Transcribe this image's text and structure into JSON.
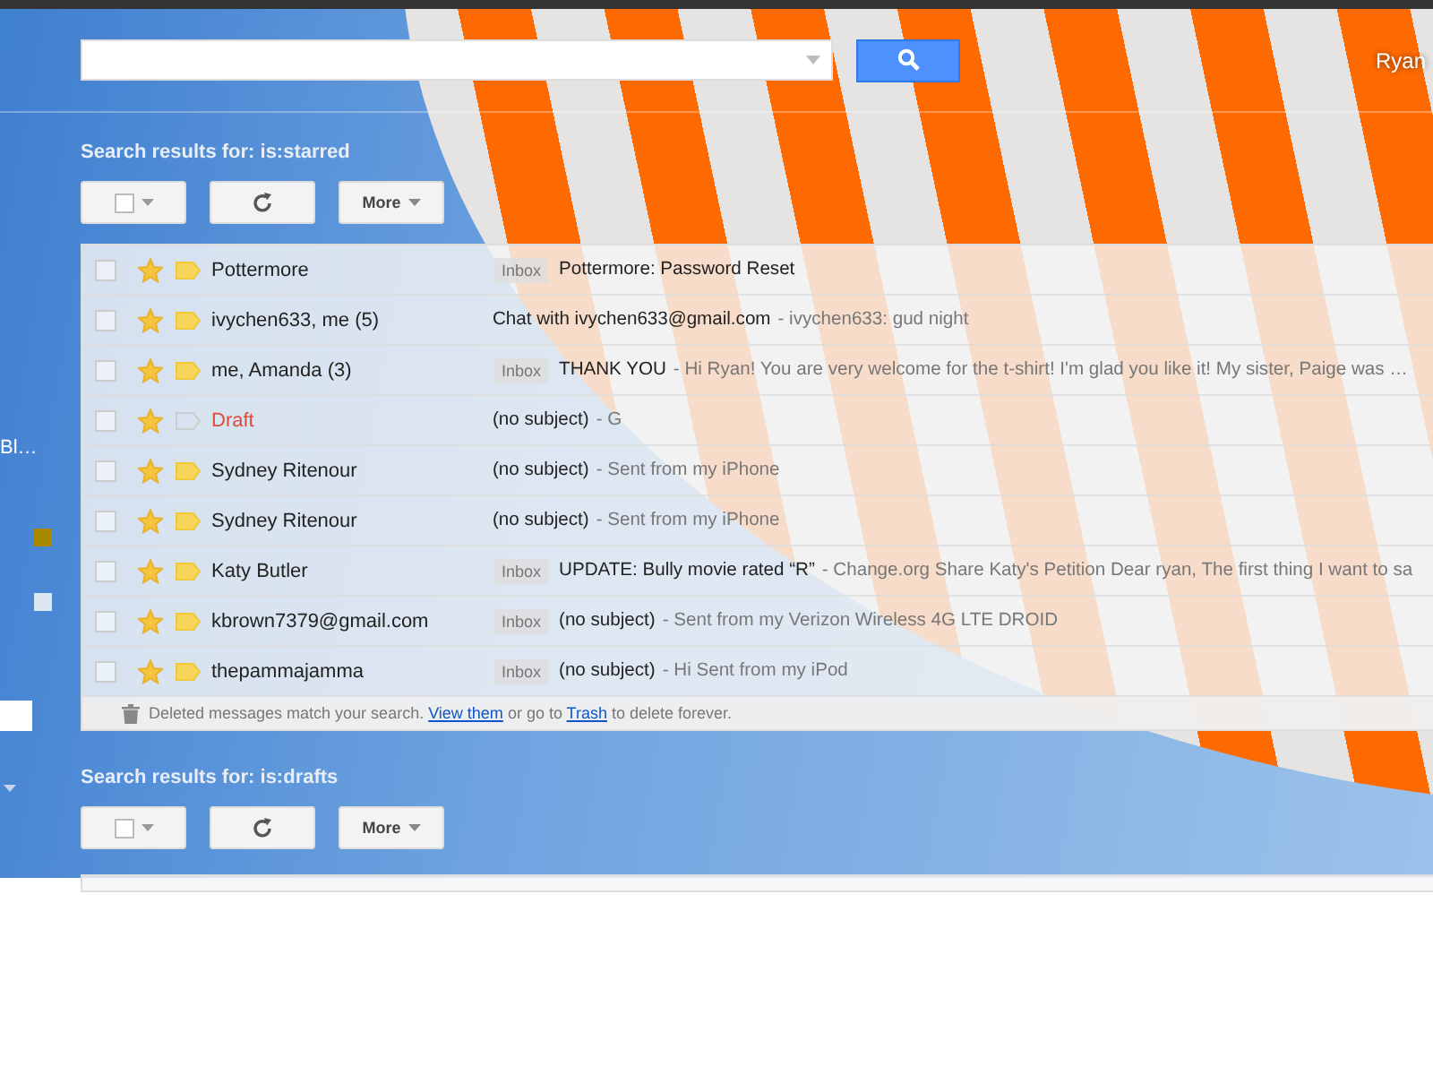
{
  "header": {
    "account": "Ryan"
  },
  "sidebar": {
    "label": "Bl…",
    "label_squares": [
      {
        "color": "#a88a00"
      },
      {
        "color": "#dde4f2"
      }
    ]
  },
  "sections": [
    {
      "title": "Search results for: is:starred",
      "more": "More",
      "rows": [
        {
          "checked": false,
          "starred": true,
          "important": true,
          "kind": "mail",
          "sender": "Pottermore",
          "badge": "Inbox",
          "subject": "Pottermore: Password Reset"
        },
        {
          "checked": false,
          "starred": true,
          "important": true,
          "kind": "mail",
          "sender": "ivychen633, me (5)",
          "subject": "Chat with ivychen633@gmail.com",
          "snippet": "- ivychen633: gud night"
        },
        {
          "checked": false,
          "starred": true,
          "important": true,
          "kind": "mail",
          "sender": "me, Amanda (3)",
          "badge": "Inbox",
          "subject": "THANK YOU",
          "snippet": "- Hi Ryan! You are very welcome for the t-shirt! I'm glad you like it! My sister, Paige was …"
        },
        {
          "checked": false,
          "starred": true,
          "important": false,
          "kind": "draft",
          "sender": "Draft",
          "subject": "(no subject)",
          "snippet": "- G"
        },
        {
          "checked": false,
          "starred": true,
          "important": true,
          "kind": "mail",
          "sender": "Sydney Ritenour",
          "subject": "(no subject)",
          "snippet": "- Sent from my iPhone"
        },
        {
          "checked": false,
          "starred": true,
          "important": true,
          "kind": "mail",
          "sender": "Sydney Ritenour",
          "subject": "(no subject)",
          "snippet": "- Sent from my iPhone"
        },
        {
          "checked": false,
          "starred": true,
          "important": true,
          "kind": "mail",
          "sender": "Katy Butler",
          "badge": "Inbox",
          "subject": "UPDATE: Bully movie rated “R”",
          "snippet": "- Change.org Share Katy's Petition Dear ryan, The first thing I want to sa"
        },
        {
          "checked": false,
          "starred": true,
          "important": true,
          "kind": "mail",
          "sender": "kbrown7379@gmail.com",
          "badge": "Inbox",
          "subject": "(no subject)",
          "snippet": "- Sent from my Verizon Wireless 4G LTE DROID"
        },
        {
          "checked": false,
          "starred": true,
          "important": true,
          "kind": "mail",
          "sender": "thepammajamma",
          "badge": "Inbox",
          "subject": "(no subject)",
          "snippet": "- Hi Sent from my iPod"
        }
      ],
      "footer": {
        "before": "Deleted messages match your search.",
        "link1": "View them",
        "middle": "or go to",
        "link2": "Trash",
        "after": "to delete forever."
      }
    },
    {
      "title": "Search results for: is:drafts",
      "more": "More"
    }
  ]
}
